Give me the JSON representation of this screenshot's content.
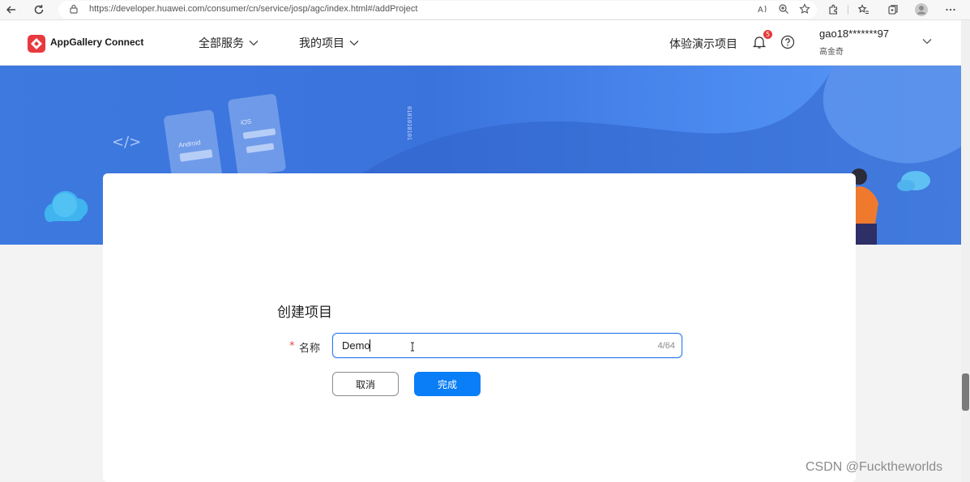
{
  "browser": {
    "url": "https://developer.huawei.com/consumer/cn/service/josp/agc/index.html#/addProject"
  },
  "header": {
    "app_name": "AppGallery Connect",
    "nav": [
      {
        "label": "全部服务"
      },
      {
        "label": "我的项目"
      }
    ],
    "demo_label": "体验演示项目",
    "notification_count": "5",
    "user": {
      "name": "gao18*******97",
      "subtitle": "高金奇"
    }
  },
  "form": {
    "title": "创建项目",
    "name_label": "名称",
    "required_mark": "*",
    "name_value": "Demo",
    "char_counter": "4/64",
    "cancel_label": "取消",
    "done_label": "完成"
  },
  "banner": {
    "android_label": "Android",
    "ios_label": "iOS",
    "code_tag": "</>",
    "binary": "0101010101"
  },
  "watermark": "CSDN @Fucktheworlds",
  "colors": {
    "primary": "#0a7ef7",
    "banner": "#3d79df",
    "badge": "#e63939",
    "logo": "#e8393f"
  }
}
